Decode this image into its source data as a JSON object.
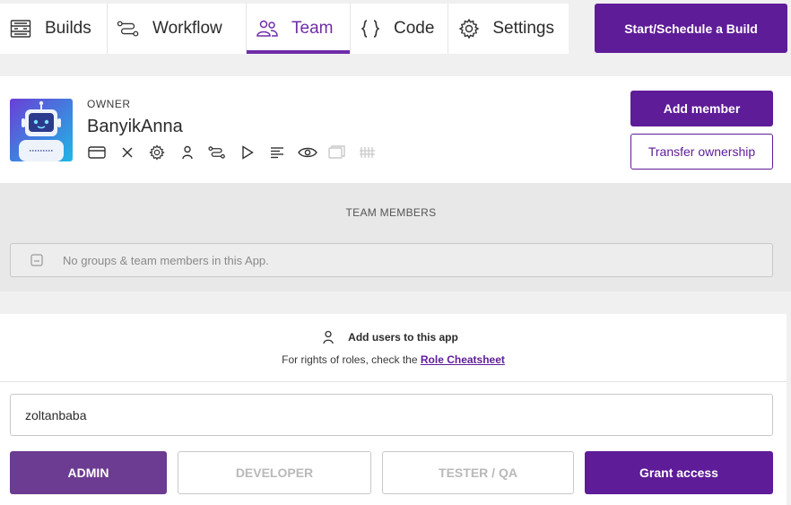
{
  "nav": {
    "tabs": [
      {
        "label": "Builds",
        "icon": "builds-icon"
      },
      {
        "label": "Workflow",
        "icon": "workflow-icon"
      },
      {
        "label": "Team",
        "icon": "team-icon",
        "active": true
      },
      {
        "label": "Code",
        "icon": "code-icon"
      },
      {
        "label": "Settings",
        "icon": "gear-icon"
      }
    ],
    "start_build_label": "Start/Schedule a Build"
  },
  "owner": {
    "role_label": "OWNER",
    "name": "BanyikAnna",
    "add_member_label": "Add member",
    "transfer_label": "Transfer ownership",
    "permission_icons": [
      "card-icon",
      "close-icon",
      "gear-icon",
      "user-icon",
      "workflow-icon",
      "play-icon",
      "list-icon",
      "eye-icon",
      "folder-icon",
      "barcode-icon"
    ]
  },
  "team_members": {
    "title": "TEAM MEMBERS",
    "empty_text": "No groups & team members in this App."
  },
  "add_users": {
    "heading": "Add users to this app",
    "sub_prefix": "For rights of roles, check the",
    "cheatsheet_link": "Role Cheatsheet",
    "input_value": "zoltanbaba",
    "roles": {
      "admin": "ADMIN",
      "developer": "DEVELOPER",
      "tester": "TESTER / QA"
    },
    "grant_label": "Grant access"
  },
  "colors": {
    "brand_purple": "#5e1c98",
    "active_role": "#6b3c91"
  }
}
